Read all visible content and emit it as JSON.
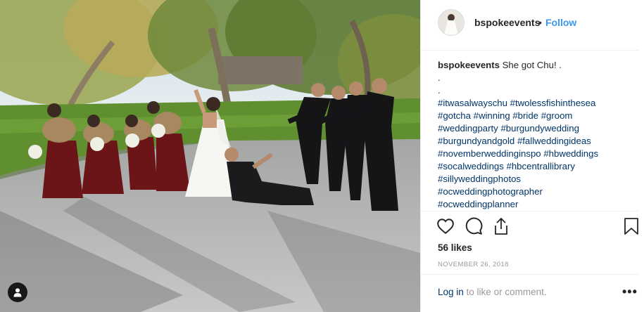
{
  "post": {
    "username": "bspokeevents",
    "separator": "•",
    "follow_label": "Follow",
    "caption_text": "She got Chu! .",
    "caption_dots": [
      ".",
      "."
    ],
    "hashtag_lines": [
      [
        "#itwasalwayschu",
        "#twolessfishinthesea"
      ],
      [
        "#gotcha",
        "#winning",
        "#bride",
        "#groom"
      ],
      [
        "#weddingparty",
        "#burgundywedding"
      ],
      [
        "#burgundyandgold",
        "#fallweddingideas"
      ],
      [
        "#novemberweddinginspo",
        "#hbweddings"
      ],
      [
        "#socalweddings",
        "#hbcentrallibrary"
      ],
      [
        "#sillyweddingphotos"
      ],
      [
        "#ocweddingphotographer"
      ],
      [
        "#ocweddingplanner"
      ]
    ],
    "likes_text": "56 likes",
    "date_text": "NOVEMBER 26, 2018",
    "login_link": "Log in",
    "login_suffix": " to like or comment.",
    "more_label": "•••"
  },
  "icons": {
    "like": "heart-icon",
    "comment": "speech-bubble-icon",
    "share": "share-icon",
    "save": "bookmark-icon",
    "tag": "user-tag-icon"
  },
  "colors": {
    "link": "#003569",
    "follow": "#3897f0",
    "text": "#262626",
    "muted": "#999999"
  }
}
